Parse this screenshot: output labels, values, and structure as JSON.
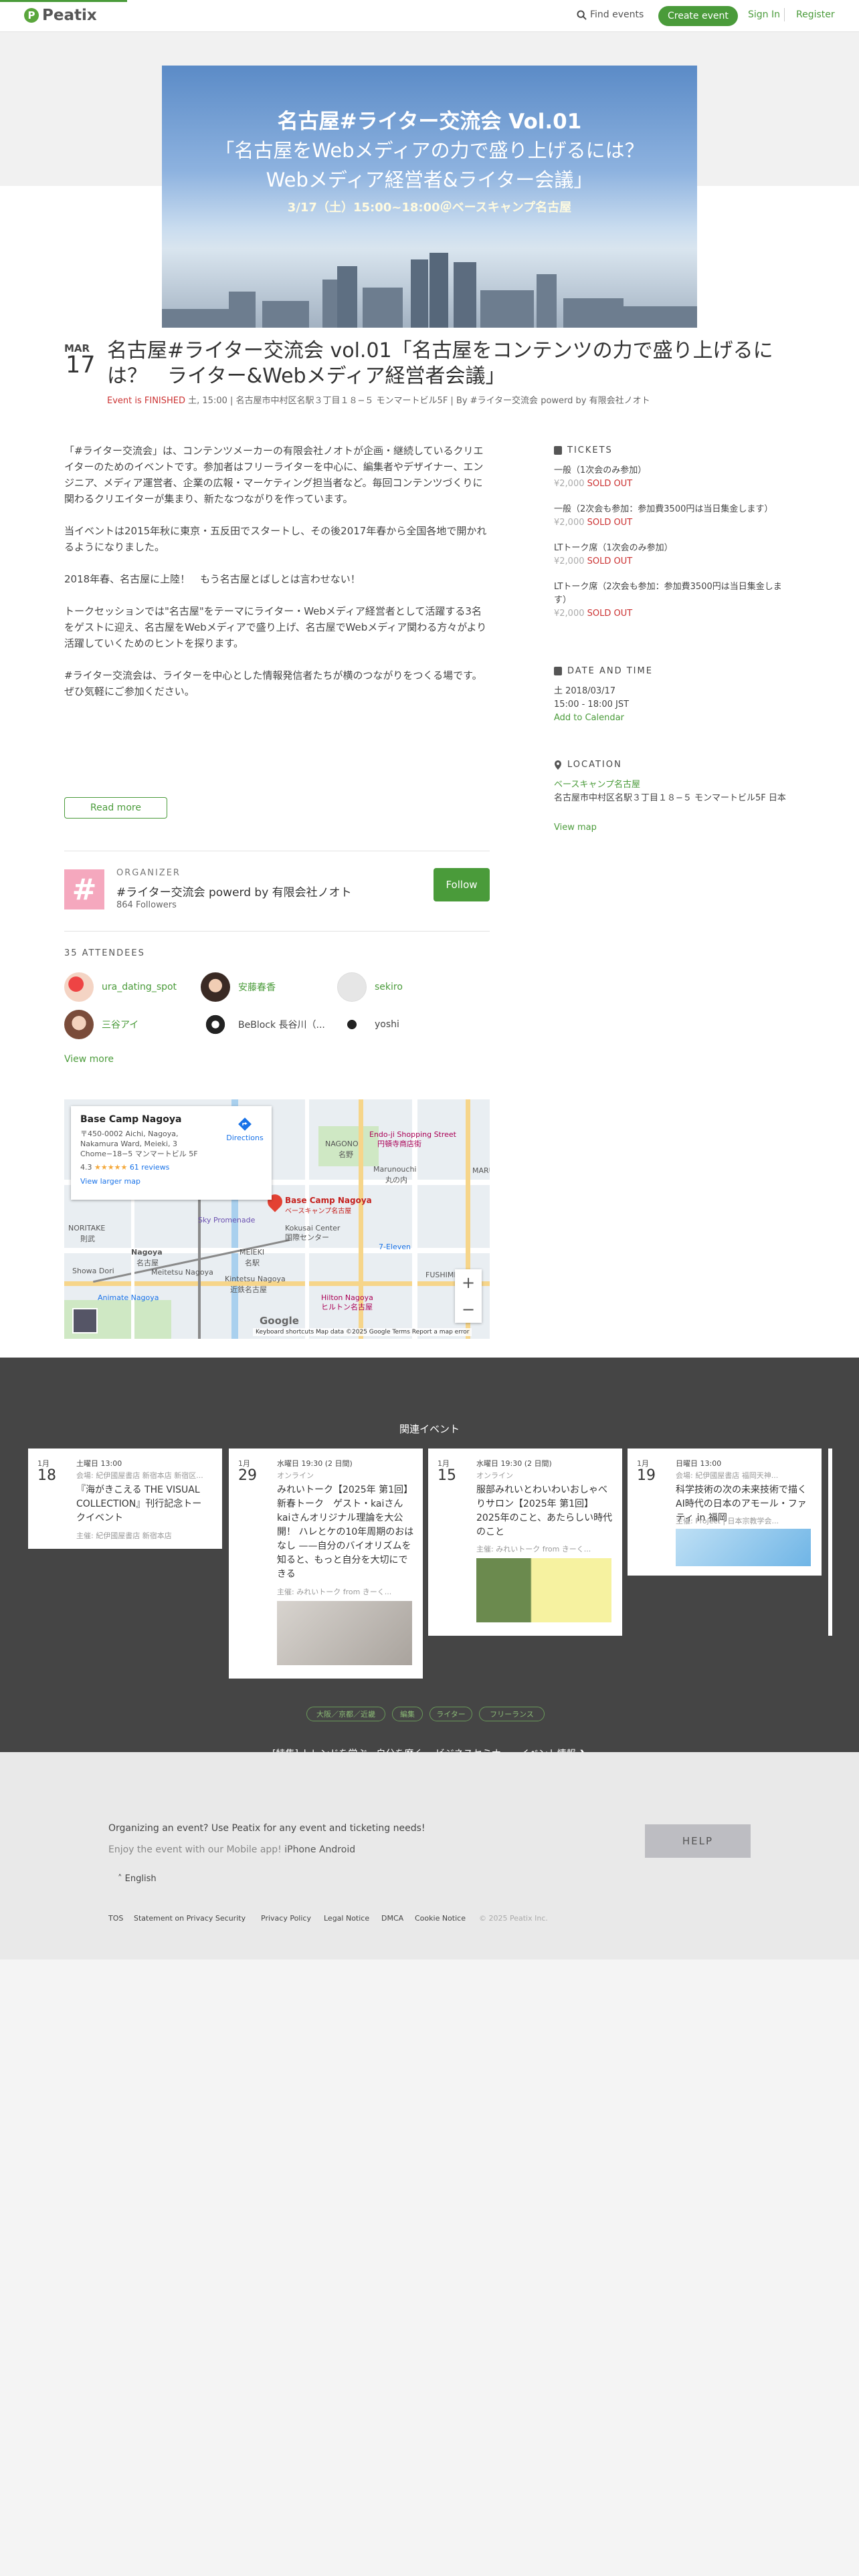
{
  "header": {
    "logo": "Peatix",
    "find_events": "Find events",
    "create_event": "Create event",
    "sign_in": "Sign In",
    "register": "Register"
  },
  "banner": {
    "line1": "名古屋#ライター交流会 Vol.01",
    "line2": "「名古屋をWebメディアの力で盛り上げるには？",
    "line3": "Webメディア経営者&ライター会議」",
    "line4": "3/17（土）15:00~18:00＠ベースキャンプ名古屋"
  },
  "event": {
    "month": "MAR",
    "day": "17",
    "title": "名古屋#ライター交流会 vol.01「名古屋をコンテンツの力で盛り上げるには？　ライター&Webメディア経営者会議」",
    "finished": "Event is FINISHED",
    "meta": " 土, 15:00 | 名古屋市中村区名駅３丁目１８−５ モンマートビル5F | By #ライター交流会 powerd by 有限会社ノオト"
  },
  "description": [
    "「#ライター交流会」は、コンテンツメーカーの有限会社ノオトが企画・継続しているクリエイターのためのイベントです。参加者はフリーライターを中心に、編集者やデザイナー、エンジニア、メディア運営者、企業の広報・マーケティング担当者など。毎回コンテンツづくりに関わるクリエイターが集まり、新たなつながりを作っています。",
    "当イベントは2015年秋に東京・五反田でスタートし、その後2017年春から全国各地で開かれるようになりました。",
    "2018年春、名古屋に上陸！　もう名古屋とばしとは言わせない！",
    "トークセッションでは\"名古屋\"をテーマにライター・Webメディア経営者として活躍する3名をゲストに迎え、名古屋をWebメディアで盛り上げ、名古屋でWebメディア関わる方々がより活躍していくためのヒントを探ります。",
    "#ライター交流会は、ライターを中心とした情報発信者たちが横のつながりをつくる場です。ぜひ気軽にご参加ください。"
  ],
  "read_more": "Read more",
  "sidebar": {
    "tickets_head": "TICKETS",
    "tickets": [
      {
        "name": "一般（1次会のみ参加）",
        "price": "¥2,000",
        "status": "SOLD OUT"
      },
      {
        "name": "一般（2次会も参加：参加費3500円は当日集金します）",
        "price": "¥2,000",
        "status": "SOLD OUT"
      },
      {
        "name": "LTトーク席（1次会のみ参加）",
        "price": "¥2,000",
        "status": "SOLD OUT"
      },
      {
        "name": "LTトーク席（2次会も参加：参加費3500円は当日集金します）",
        "price": "¥2,000",
        "status": "SOLD OUT"
      }
    ],
    "date_head": "DATE AND TIME",
    "date": "土 2018/03/17",
    "time": "15:00 - 18:00 JST",
    "add_calendar": "Add to Calendar",
    "location_head": "LOCATION",
    "venue": "ベースキャンプ名古屋",
    "address": "名古屋市中村区名駅３丁目１８−５ モンマートビル5F 日本",
    "view_map": "View map"
  },
  "organizer": {
    "label": "ORGANIZER",
    "name": "#ライター交流会 powerd by 有限会社ノオト",
    "followers": "864 Followers",
    "follow": "Follow",
    "badge": "#"
  },
  "attendees": {
    "head": "35 ATTENDEES",
    "list": [
      {
        "name": "ura_dating_spot"
      },
      {
        "name": "安藤春香"
      },
      {
        "name": "sekiro"
      },
      {
        "name": "三谷アイ"
      },
      {
        "name": "BeBlock 長谷川（..."
      },
      {
        "name": "yoshi"
      }
    ],
    "view_more": "View more"
  },
  "map": {
    "place": "Base Camp Nagoya",
    "address": "〒450-0002 Aichi, Nagoya, Nakamura Ward, Meieki, 3 Chome−18−5 マンマートビル 5F",
    "rating": "4.3",
    "stars": "★★★★★",
    "reviews": "61 reviews",
    "directions": "Directions",
    "view_larger": "View larger map",
    "pin_label": "Base Camp Nagoya",
    "pin_sub": "ベースキャンプ名古屋",
    "labels": [
      "NAGONO",
      "名野",
      "Endo-ji Shopping Street",
      "円頓寺商店街",
      "Marunouchi",
      "丸の内",
      "Kokusai Center",
      "国際センター",
      "Sky Promenade",
      "NORITAKE",
      "則武",
      "Nagoya",
      "名古屋",
      "MEIEKI",
      "名駅",
      "Meitetsu Nagoya",
      "Kintetsu Nagoya",
      "近鉄名古屋",
      "7-Eleven",
      "Hilton Nagoya",
      "ヒルトン名古屋",
      "Animate Nagoya",
      "Showa Dori",
      "FUSHIMI",
      "MARU"
    ],
    "zoom_in": "+",
    "zoom_out": "−",
    "google": "Google",
    "footer": "Keyboard shortcuts   Map data ©2025 Google   Terms   Report a map error"
  },
  "related": {
    "title": "関連イベント",
    "cards": [
      {
        "month": "1月",
        "day": "18",
        "time": "土曜日 13:00",
        "loc": "会場: 紀伊國屋書店 新宿本店 新宿区...",
        "title": "『海がきこえる THE VISUAL COLLECTION』刊行記念トークイベント",
        "org": "主催: 紀伊國屋書店 新宿本店"
      },
      {
        "month": "1月",
        "day": "29",
        "time": "水曜日 19:30 (2 日間)",
        "loc": "オンライン",
        "title": "みれいトーク【2025年 第1回】 新春トーク　ゲスト・kaiさん kaiさんオリジナル理論を大公開！ ハレとケの10年周期のおはなし ——自分のバイオリズムを知ると、もっと自分を大切にできる",
        "org": "主催: みれいトーク from きーく..."
      },
      {
        "month": "1月",
        "day": "15",
        "time": "水曜日 19:30 (2 日間)",
        "loc": "オンライン",
        "title": "服部みれいとわいわいおしゃべりサロン【2025年 第1回】 2025年のこと、あたらしい時代のこと",
        "org": "主催: みれいトーク from きーく..."
      },
      {
        "month": "1月",
        "day": "19",
        "time": "日曜日 13:00",
        "loc": "会場: 紀伊國屋書店 福岡天神...",
        "title": "科学技術の次の未来技術で描くAI時代の日本のアモール・ファティ in 福岡",
        "org": "主催: Project | 日本宗教学会..."
      }
    ],
    "tags": [
      "大阪／京都／近畿",
      "編集",
      "ライター",
      "フリーランス"
    ],
    "link": "[特集] トレンドを学ぶ、自分を磨く。 ビジネスセミナー・イベント情報 ❯"
  },
  "footer": {
    "line1": "Organizing an event? Use Peatix for any event and ticketing needs!",
    "line2": "Enjoy the event with our Mobile app!",
    "iphone": "iPhone",
    "android": "Android",
    "lang": "English",
    "help": "HELP",
    "links": [
      "TOS",
      "Statement on Privacy Security",
      "Privacy Policy",
      "Legal Notice",
      "DMCA",
      "Cookie Notice"
    ],
    "copyright": "© 2025 Peatix Inc."
  },
  "colors": {
    "brand": "#4a9b3a",
    "sold_out": "#cc3333",
    "dark_band": "#454545"
  }
}
